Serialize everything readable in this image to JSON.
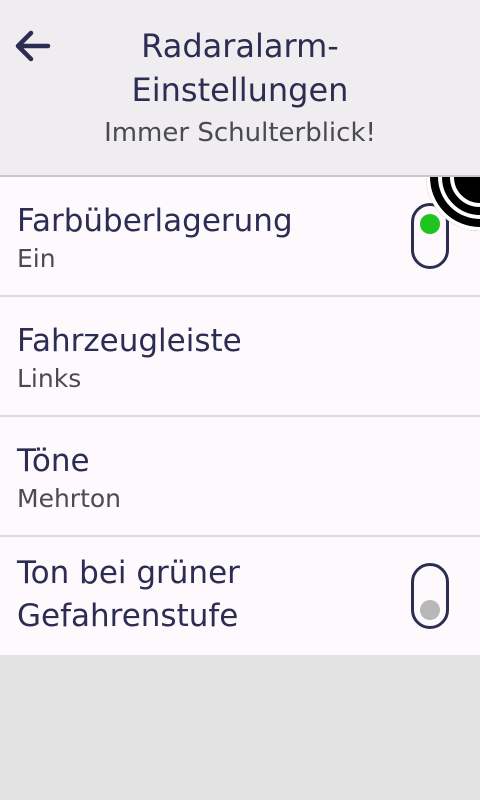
{
  "header": {
    "title": "Radaralarm-Einstellungen",
    "subtitle": "Immer Schulterblick!"
  },
  "settings": [
    {
      "title": "Farbüberlagerung",
      "value": "Ein",
      "toggle_on": true
    },
    {
      "title": "Fahrzeugleiste",
      "value": "Links"
    },
    {
      "title": "Töne",
      "value": "Mehrton"
    },
    {
      "title": "Ton bei grüner Gefahrenstufe",
      "toggle_on": false
    }
  ],
  "colors": {
    "text_primary": "#2b2d52",
    "toggle_on_knob": "#1ec51e",
    "toggle_off_knob": "#b8b8b8"
  },
  "icons": {
    "back": "arrow-left-icon",
    "corner": "radar-signal-icon"
  }
}
